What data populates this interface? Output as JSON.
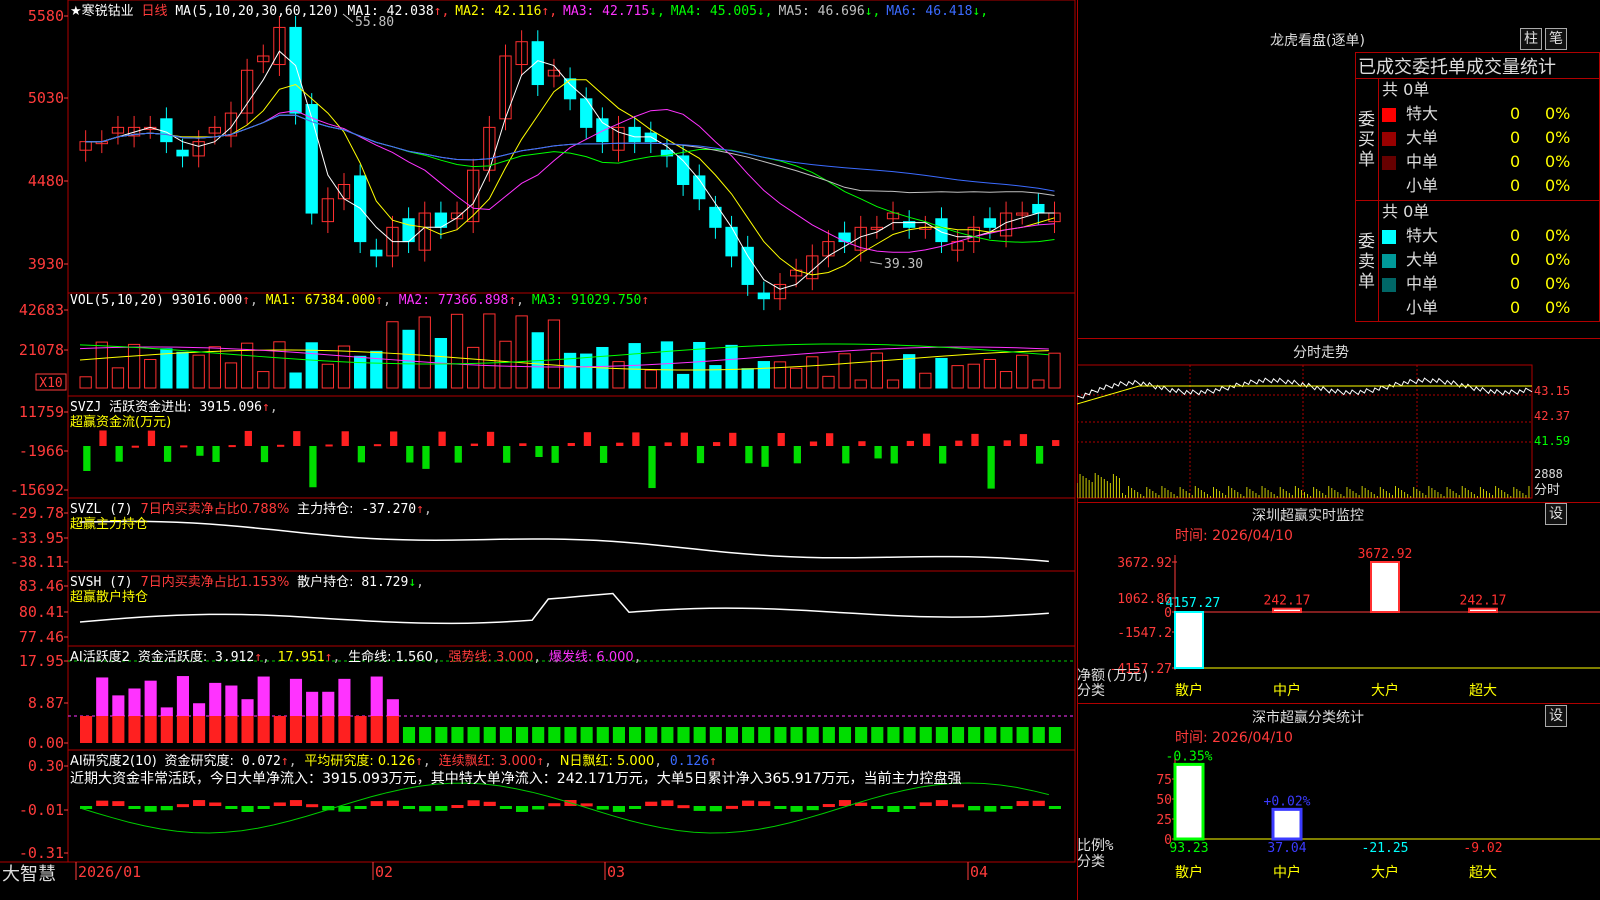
{
  "chart": {
    "stock_name": "寒锐钴业",
    "period": "日线",
    "ma_header": "MA(5,10,20,30,60,120)",
    "ma": [
      {
        "label": "MA1:",
        "value": "42.038",
        "arrow": "↑",
        "color": "#ffffff"
      },
      {
        "label": "MA2:",
        "value": "42.116",
        "arrow": "↑",
        "color": "#ffff00"
      },
      {
        "label": "MA3:",
        "value": "42.715",
        "arrow": "↓",
        "color": "#ff33ff"
      },
      {
        "label": "MA4:",
        "value": "45.005",
        "arrow": "↓",
        "color": "#00ff00"
      },
      {
        "label": "MA5:",
        "value": "46.696",
        "arrow": "↓",
        "color": "#c0c0c0"
      },
      {
        "label": "MA6:",
        "value": "46.418",
        "arrow": "↓",
        "color": "#3b6bff"
      }
    ],
    "price_axis": [
      "5580",
      "5030",
      "4480",
      "3930"
    ],
    "high_label": "55.80",
    "low_label": "39.30",
    "vol_header": {
      "name": "VOL(5,10,20)",
      "value": "93016.000",
      "ma1": "MA1: 67384.000",
      "ma2": "MA2: 77366.898",
      "ma3": "MA3: 91029.750"
    },
    "vol_axis": [
      "42683",
      "21078"
    ],
    "vol_unit": "X10",
    "svzj": {
      "name": "SVZJ",
      "label": "活跃资金进出:",
      "value": "3915.096",
      "sub": "超赢资金流(万元)",
      "axis": [
        "11759",
        "-1966",
        "-15692"
      ]
    },
    "svzl": {
      "name": "SVZL (7)",
      "pct": "7日内买卖净占比0.788%",
      "label": "主力持仓:",
      "value": "-37.270",
      "sub": "超赢主力持仓",
      "axis": [
        "-29.78",
        "-33.95",
        "-38.11"
      ]
    },
    "svsh": {
      "name": "SVSH (7)",
      "pct": "7日内买卖净占比1.153%",
      "label": "散户持仓:",
      "value": "81.729",
      "sub": "超赢散户持仓",
      "axis": [
        "83.46",
        "80.41",
        "77.46"
      ]
    },
    "ai1": {
      "name": "AI活跃度2",
      "label": "资金活跃度:",
      "value": "3.912",
      "v2": "17.951",
      "life": "生命线: 1.560",
      "strong": "强势线: 3.000",
      "burst": "爆发线: 6.000",
      "axis": [
        "17.95",
        "8.87",
        "0.00"
      ]
    },
    "ai2": {
      "name": "AI研究度2(10)",
      "label": "资金研究度:",
      "value": "0.072",
      "avg": "平均研究度: 0.126",
      "red": "连续飘红: 3.000",
      "nred": "N日飘红: 5.000",
      "v5": "0.126",
      "axis": [
        "0.30",
        "-0.01",
        "-0.31"
      ]
    },
    "comment": "近期大资金非常活跃，今日大单净流入：3915.093万元，其中特大单净流入：242.171万元，大单5日累计净入365.917万元，当前主力控盘强",
    "xaxis": [
      "2026/01",
      "02",
      "03",
      "04"
    ],
    "logo": "大智慧"
  },
  "right": {
    "dragon_title": "龙虎看盘(逐单)",
    "btn_zhu": "柱",
    "btn_bi": "笔",
    "stat_title": "已成交委托单成交量统计",
    "buy_side": "委买单",
    "sell_side": "委卖单",
    "buy_total": "共 0单",
    "sell_total": "共 0单",
    "buy_rows": [
      {
        "name": "特大",
        "count": "0",
        "pct": "0%",
        "color": "#ff0000"
      },
      {
        "name": "大单",
        "count": "0",
        "pct": "0%",
        "color": "#990000"
      },
      {
        "name": "中单",
        "count": "0",
        "pct": "0%",
        "color": "#660000"
      },
      {
        "name": "小单",
        "count": "0",
        "pct": "0%",
        "color": "#000000"
      }
    ],
    "sell_rows": [
      {
        "name": "特大",
        "count": "0",
        "pct": "0%",
        "color": "#00ffff"
      },
      {
        "name": "大单",
        "count": "0",
        "pct": "0%",
        "color": "#009999"
      },
      {
        "name": "中单",
        "count": "0",
        "pct": "0%",
        "color": "#006666"
      },
      {
        "name": "小单",
        "count": "0",
        "pct": "0%",
        "color": "#000000"
      }
    ],
    "intraday_title": "分时走势",
    "intraday_axis": [
      "43.15",
      "42.37",
      "41.59",
      "2888"
    ],
    "intraday_unit": "分时",
    "sz_monitor_title": "深圳超赢实时监控",
    "sz_date": "时间: 2026/04/10",
    "sz_axis": [
      "3672.92",
      "1062.86",
      "0",
      "-1547.2",
      "-4157.27"
    ],
    "sz_ylabel": "净额(万元)",
    "sz_xlabel": "分类",
    "sz_bars": [
      {
        "label": "-4157.27",
        "value": -4157.27,
        "cat": "散户"
      },
      {
        "label": "242.17",
        "value": 242.17,
        "cat": "中户"
      },
      {
        "label": "3672.92",
        "value": 3672.92,
        "cat": "大户"
      },
      {
        "label": "242.17",
        "value": 242.17,
        "cat": "超大"
      }
    ],
    "sz_class_title": "深市超赢分类统计",
    "sz_class_date": "时间: 2026/04/10",
    "sz_class_axis": [
      "75",
      "50",
      "25",
      "0"
    ],
    "sz_class_ylabel": "比例%",
    "sz_class_xlabel": "分类",
    "sz_class_bars": [
      {
        "top": "-0.35%",
        "value": 93.23,
        "label": "93.23",
        "cat": "散户"
      },
      {
        "top": "+0.02%",
        "value": 37.04,
        "label": "37.04",
        "cat": "中户"
      },
      {
        "top": "",
        "value": -21.25,
        "label": "-21.25",
        "cat": "大户"
      },
      {
        "top": "",
        "value": -9.02,
        "label": "-9.02",
        "cat": "超大"
      }
    ],
    "set_label": "设"
  }
}
